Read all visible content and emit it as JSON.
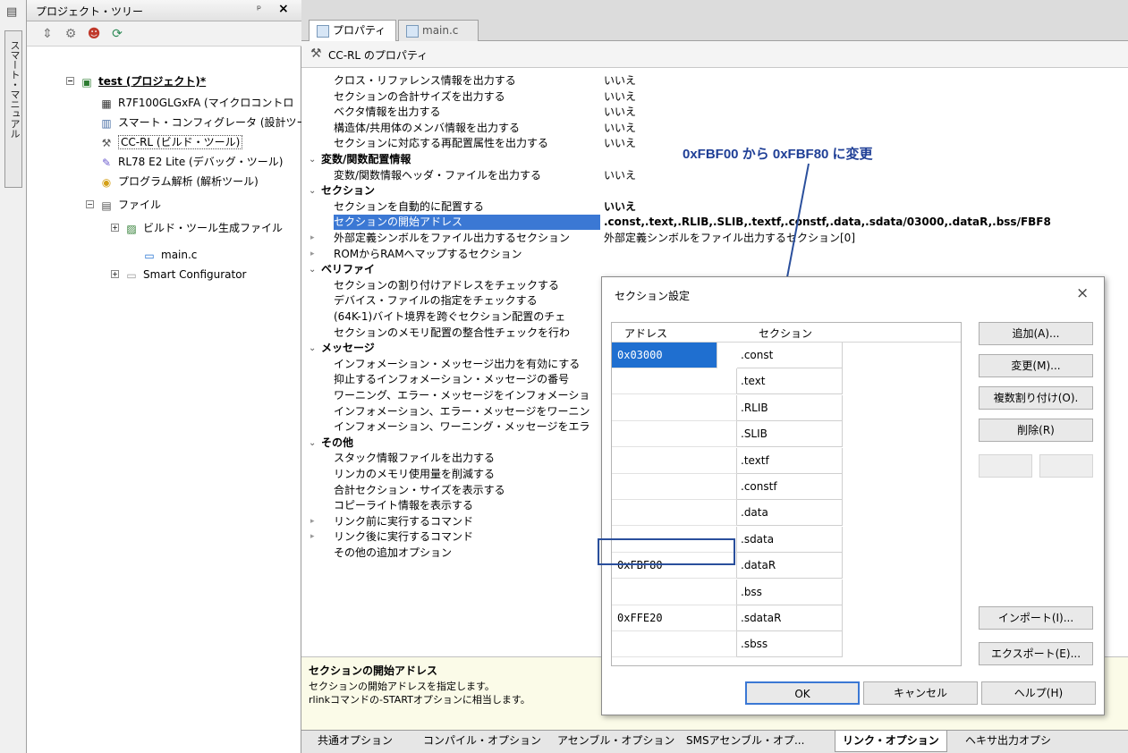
{
  "vertical_tab": {
    "label": "スマート・マニュアル"
  },
  "tree": {
    "title": "プロジェクト・ツリー",
    "pin": "ᵖ",
    "close": "×",
    "nodes": [
      {
        "label": "test (プロジェクト)*",
        "icon": "project-icon"
      },
      {
        "label": "R7F100GLGxFA (マイクロコントロ",
        "icon": "chip-icon"
      },
      {
        "label": "スマート・コンフィグレータ (設計ツー",
        "icon": "configurator-icon"
      },
      {
        "label": "CC-RL (ビルド・ツール)",
        "icon": "build-tool-icon"
      },
      {
        "label": "RL78 E2 Lite (デバッグ・ツール)",
        "icon": "debug-tool-icon"
      },
      {
        "label": "プログラム解析 (解析ツール)",
        "icon": "analysis-icon"
      },
      {
        "label": "ファイル",
        "icon": "folder-icon"
      },
      {
        "label": "ビルド・ツール生成ファイル",
        "icon": "generated-files-icon"
      },
      {
        "label": "main.c",
        "icon": "c-file-icon"
      },
      {
        "label": "Smart Configurator",
        "icon": "folder-icon"
      }
    ]
  },
  "tabs": {
    "properties": "プロパティ",
    "main": "main.c"
  },
  "props": {
    "title": "CC-RL のプロパティ",
    "rows": [
      {
        "type": "row",
        "name": "クロス・リファレンス情報を出力する",
        "value": "いいえ"
      },
      {
        "type": "row",
        "name": "セクションの合計サイズを出力する",
        "value": "いいえ"
      },
      {
        "type": "row",
        "name": "ベクタ情報を出力する",
        "value": "いいえ"
      },
      {
        "type": "row",
        "name": "構造体/共用体のメンバ情報を出力する",
        "value": "いいえ"
      },
      {
        "type": "row",
        "name": "セクションに対応する再配置属性を出力する",
        "value": "いいえ"
      },
      {
        "type": "cat",
        "name": "変数/関数配置情報",
        "value": ""
      },
      {
        "type": "row",
        "name": "変数/関数情報ヘッダ・ファイルを出力する",
        "value": "いいえ"
      },
      {
        "type": "cat",
        "name": "セクション",
        "value": ""
      },
      {
        "type": "row",
        "name": "セクションを自動的に配置する",
        "value": "いいえ"
      },
      {
        "type": "row",
        "name": "セクションの開始アドレス",
        "value": ".const,.text,.RLIB,.SLIB,.textf,.constf,.data,.sdata/03000,.dataR,.bss/FBF8"
      },
      {
        "type": "sub",
        "name": "外部定義シンボルをファイル出力するセクション",
        "value": "外部定義シンボルをファイル出力するセクション[0]"
      },
      {
        "type": "sub",
        "name": "ROMからRAMへマップするセクション",
        "value": ""
      },
      {
        "type": "cat",
        "name": "ベリファイ",
        "value": ""
      },
      {
        "type": "row",
        "name": "セクションの割り付けアドレスをチェックする",
        "value": ""
      },
      {
        "type": "row",
        "name": "デバイス・ファイルの指定をチェックする",
        "value": ""
      },
      {
        "type": "row",
        "name": "(64K-1)バイト境界を跨ぐセクション配置のチェ",
        "value": ""
      },
      {
        "type": "row",
        "name": "セクションのメモリ配置の整合性チェックを行わ",
        "value": ""
      },
      {
        "type": "cat",
        "name": "メッセージ",
        "value": ""
      },
      {
        "type": "row",
        "name": "インフォメーション・メッセージ出力を有効にする",
        "value": ""
      },
      {
        "type": "row",
        "name": "抑止するインフォメーション・メッセージの番号",
        "value": ""
      },
      {
        "type": "row",
        "name": "ワーニング、エラー・メッセージをインフォメーショ",
        "value": ""
      },
      {
        "type": "row",
        "name": "インフォメーション、エラー・メッセージをワーニン",
        "value": ""
      },
      {
        "type": "row",
        "name": "インフォメーション、ワーニング・メッセージをエラ",
        "value": ""
      },
      {
        "type": "cat",
        "name": "その他",
        "value": ""
      },
      {
        "type": "row",
        "name": "スタック情報ファイルを出力する",
        "value": ""
      },
      {
        "type": "row",
        "name": "リンカのメモリ使用量を削減する",
        "value": ""
      },
      {
        "type": "row",
        "name": "合計セクション・サイズを表示する",
        "value": ""
      },
      {
        "type": "row",
        "name": "コピーライト情報を表示する",
        "value": ""
      },
      {
        "type": "sub",
        "name": "リンク前に実行するコマンド",
        "value": ""
      },
      {
        "type": "sub",
        "name": "リンク後に実行するコマンド",
        "value": ""
      },
      {
        "type": "row",
        "name": "その他の追加オプション",
        "value": ""
      }
    ],
    "description": {
      "title": "セクションの開始アドレス",
      "line1": "セクションの開始アドレスを指定します。",
      "line2": "rlinkコマンドの-STARTオプションに相当します。"
    }
  },
  "bottom_tabs": [
    "共通オプション",
    "コンパイル・オプション",
    "アセンブル・オプション",
    "SMSアセンブル・オプ...",
    "リンク・オプション",
    "ヘキサ出力オプシ"
  ],
  "annotation": "0xFBF00 から 0xFBF80 に変更",
  "dialog": {
    "title": "セクション設定",
    "close": "×",
    "col_address": "アドレス",
    "col_section": "セクション",
    "rows": [
      {
        "address": "0x03000",
        "section": ".const"
      },
      {
        "address": "",
        "section": ".text"
      },
      {
        "address": "",
        "section": ".RLIB"
      },
      {
        "address": "",
        "section": ".SLIB"
      },
      {
        "address": "",
        "section": ".textf"
      },
      {
        "address": "",
        "section": ".constf"
      },
      {
        "address": "",
        "section": ".data"
      },
      {
        "address": "",
        "section": ".sdata"
      },
      {
        "address": "0xFBF80",
        "section": ".dataR"
      },
      {
        "address": "",
        "section": ".bss"
      },
      {
        "address": "0xFFE20",
        "section": ".sdataR"
      },
      {
        "address": "",
        "section": ".sbss"
      }
    ],
    "buttons": {
      "add": "追加(A)...",
      "change": "変更(M)...",
      "multi": "複数割り付け(O).",
      "delete": "削除(R)",
      "import": "インポート(I)...",
      "export": "エクスポート(E)...",
      "ok": "OK",
      "cancel": "キャンセル",
      "help": "ヘルプ(H)"
    }
  }
}
